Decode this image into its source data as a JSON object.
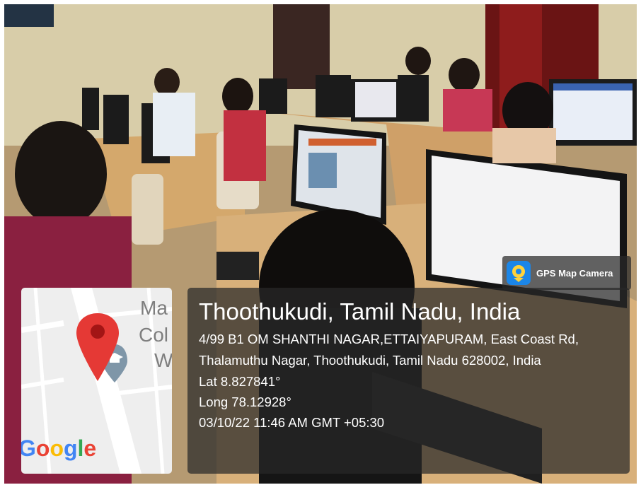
{
  "overlay": {
    "app_name": "GPS Map Camera",
    "app_icon": "location-pin-icon",
    "location_title": "Thoothukudi, Tamil Nadu, India",
    "address": "4/99 B1 OM SHANTHI NAGAR,ETTAIYAPURAM, East Coast Rd, Thalamuthu Nagar, Thoothukudi, Tamil Nadu 628002, India",
    "latitude": "Lat 8.827841°",
    "longitude": "Long 78.12928°",
    "timestamp": "03/10/22 11:46 AM GMT +05:30"
  },
  "map": {
    "label_lines": [
      "Ma",
      "Col",
      "W"
    ],
    "brand": "Google",
    "marker": "map-marker-icon",
    "poi": "graduation-cap-icon",
    "colors": {
      "marker": "#e53935",
      "road": "#ffffff",
      "land": "#eeeeee",
      "poi": "#7f96a8"
    }
  }
}
